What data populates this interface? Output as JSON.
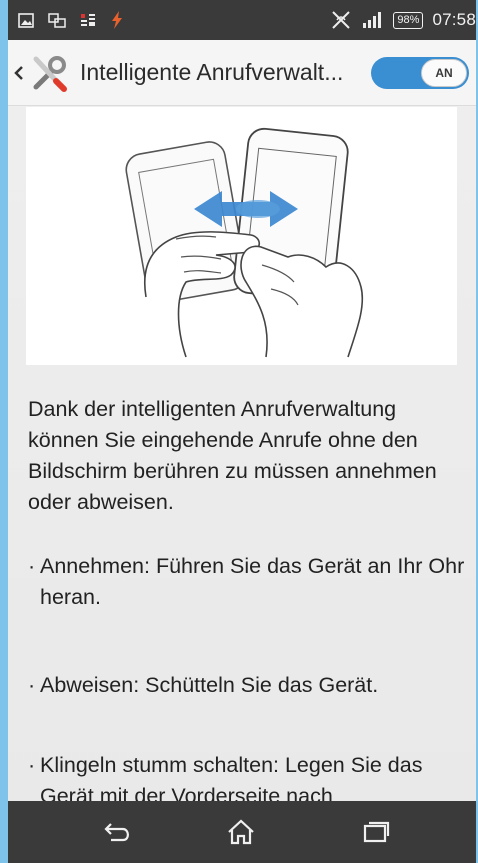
{
  "status_bar": {
    "icons_left": [
      "gallery-icon",
      "screen-mirror-icon",
      "data-icon",
      "charging-icon"
    ],
    "icons_right": [
      "nfc-icon",
      "signal-icon"
    ],
    "battery": "98%",
    "time": "07:58"
  },
  "action_bar": {
    "title": "Intelligente Anrufverwalt...",
    "toggle_label": "AN",
    "toggle_state": "on"
  },
  "content": {
    "description": "Dank der intelligenten Anrufverwaltung können Sie eingehende Anrufe ohne den Bildschirm berühren zu müssen annehmen oder abweisen.",
    "bullets": [
      "Annehmen: Führen Sie das Gerät an Ihr Ohr heran.",
      "Abweisen: Schütteln Sie das Gerät.",
      "Klingeln stumm schalten: Legen Sie das Gerät mit der Vorderseite nach"
    ],
    "bullet_char": "·"
  },
  "nav_bar": {
    "buttons": [
      "back-icon",
      "home-icon",
      "recent-apps-icon"
    ]
  },
  "colors": {
    "accent": "#3a8fd3",
    "status_bar": "#3a3a3a",
    "background": "#efefef"
  }
}
